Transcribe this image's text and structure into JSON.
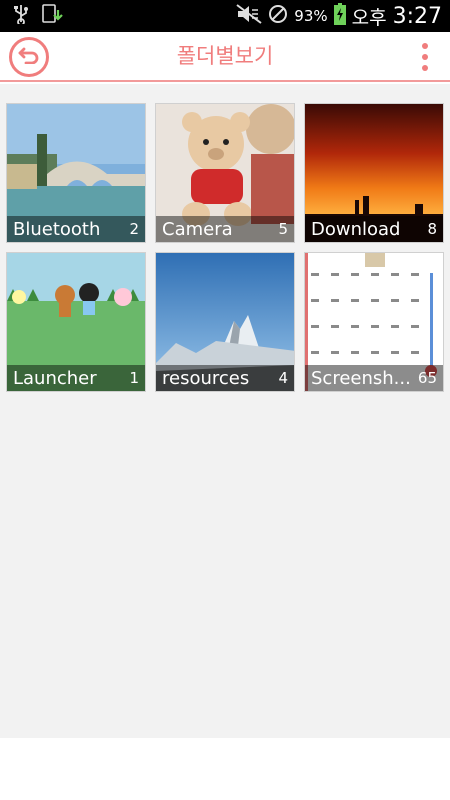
{
  "status_bar": {
    "icons": [
      "usb-icon",
      "download-status-icon",
      "mute-icon",
      "no-disturb-icon",
      "battery-charging-icon"
    ],
    "battery_percent": "93%",
    "ampm": "오후",
    "time": "3:27"
  },
  "app_bar": {
    "title": "폴더별보기",
    "back_icon": "back-arrow-icon",
    "menu_icon": "more-vert-icon"
  },
  "folders": [
    {
      "name": "Bluetooth",
      "count": "2"
    },
    {
      "name": "Camera",
      "count": "5"
    },
    {
      "name": "Download",
      "count": "8"
    },
    {
      "name": "Launcher",
      "count": "1"
    },
    {
      "name": "resources",
      "count": "4"
    },
    {
      "name": "Screensh...",
      "count": "65"
    }
  ],
  "colors": {
    "accent": "#f07d7d",
    "status_bar_bg": "#000000",
    "content_bg": "#f2f2f2"
  }
}
